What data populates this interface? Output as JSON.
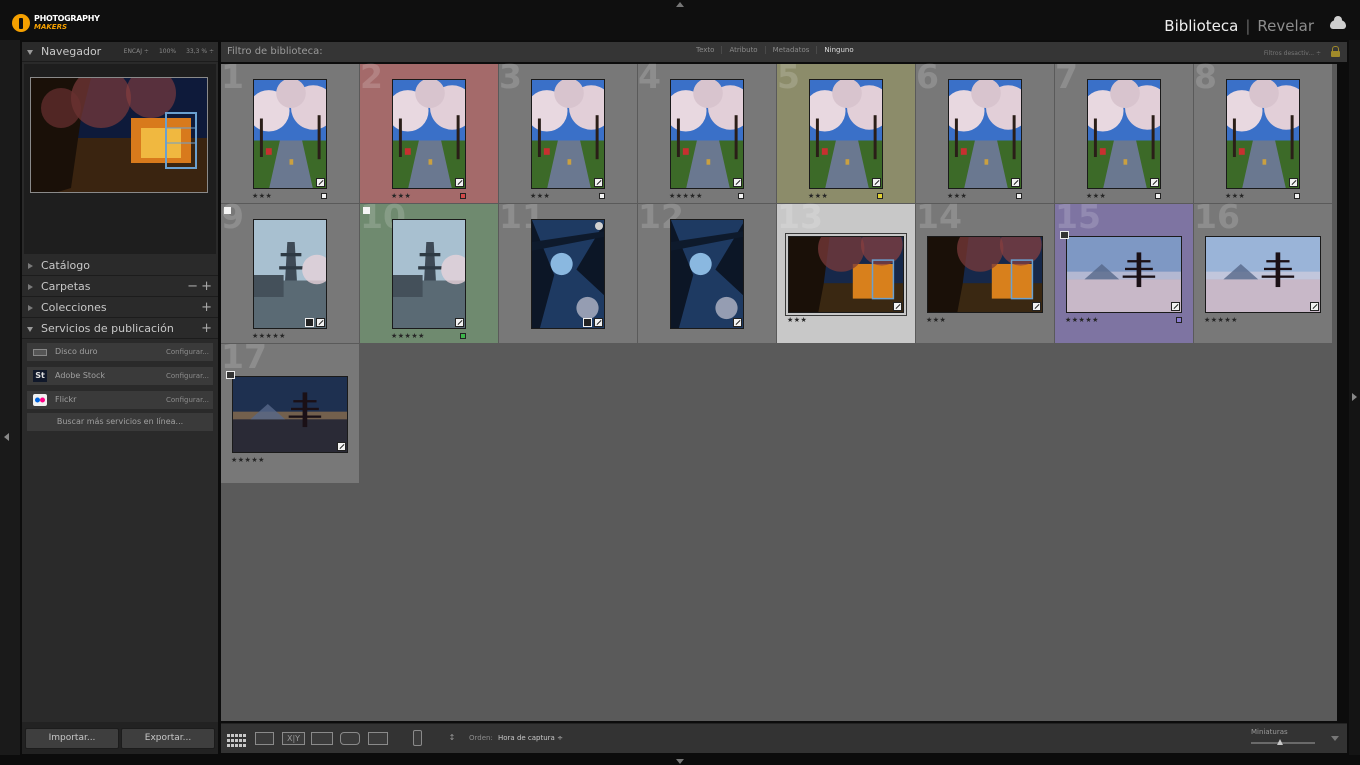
{
  "app": {
    "logo_line1": "PHOTOGRAPHY",
    "logo_line2": "MAKERS",
    "modules": {
      "active": "Biblioteca",
      "other": "Revelar",
      "separator": "|"
    }
  },
  "left_panel": {
    "navigator": {
      "title": "Navegador",
      "zoom_options": [
        "ENCAJ ÷",
        "100%",
        "33,3 % ÷"
      ]
    },
    "sections": [
      {
        "label": "Catálogo",
        "action": ""
      },
      {
        "label": "Carpetas",
        "action": "+",
        "action2": "−"
      },
      {
        "label": "Colecciones",
        "action": "+"
      },
      {
        "label": "Servicios de publicación",
        "action": "+"
      }
    ],
    "publish_services": [
      {
        "name": "Disco duro",
        "configure": "Configurar...",
        "icon": "hard-drive-icon"
      },
      {
        "name": "Adobe Stock",
        "configure": "Configurar...",
        "icon": "adobe-stock-icon"
      },
      {
        "name": "Flickr",
        "configure": "Configurar...",
        "icon": "flickr-icon"
      }
    ],
    "find_more": "Buscar más servicios en línea...",
    "import_label": "Importar...",
    "export_label": "Exportar..."
  },
  "filter_bar": {
    "title": "Filtro de biblioteca:",
    "tabs": [
      "Texto",
      "Atributo",
      "Metadatos",
      "Ninguno"
    ],
    "selected_tab": "Ninguno",
    "preset": "Filtros desactiv... ÷"
  },
  "grid": {
    "cells": [
      {
        "num": "1",
        "stars": "★★★",
        "color": "none",
        "label": "white",
        "scene": "blossom"
      },
      {
        "num": "2",
        "stars": "★★★",
        "color": "red",
        "label": "red",
        "scene": "blossom"
      },
      {
        "num": "3",
        "stars": "★★★",
        "color": "none",
        "label": "white",
        "scene": "blossom"
      },
      {
        "num": "4",
        "stars": "★★★★★",
        "color": "none",
        "label": "white",
        "scene": "blossom"
      },
      {
        "num": "5",
        "stars": "★★★",
        "color": "yellow",
        "label": "yellow",
        "scene": "blossom"
      },
      {
        "num": "6",
        "stars": "★★★",
        "color": "none",
        "label": "white",
        "scene": "blossom"
      },
      {
        "num": "7",
        "stars": "★★★",
        "color": "none",
        "label": "white",
        "scene": "blossom"
      },
      {
        "num": "8",
        "stars": "★★★",
        "color": "none",
        "label": "white",
        "scene": "blossom"
      },
      {
        "num": "9",
        "stars": "★★★★★",
        "color": "none",
        "label": "",
        "scene": "pagoda-mist"
      },
      {
        "num": "10",
        "stars": "★★★★★",
        "color": "green",
        "label": "green",
        "scene": "pagoda-mist"
      },
      {
        "num": "11",
        "stars": "",
        "color": "none",
        "label": "",
        "scene": "night-tree"
      },
      {
        "num": "12",
        "stars": "",
        "color": "none",
        "label": "",
        "scene": "night-tree"
      },
      {
        "num": "13",
        "stars": "★★★",
        "color": "selected",
        "label": "",
        "scene": "night-lanterns"
      },
      {
        "num": "14",
        "stars": "★★★",
        "color": "none",
        "label": "",
        "scene": "night-lanterns"
      },
      {
        "num": "15",
        "stars": "★★★★★",
        "color": "purple",
        "label": "purple",
        "scene": "pagoda-dusk"
      },
      {
        "num": "16",
        "stars": "★★★★★",
        "color": "none",
        "label": "",
        "scene": "pagoda-day"
      },
      {
        "num": "17",
        "stars": "★★★★★",
        "color": "none",
        "label": "",
        "scene": "pagoda-night"
      }
    ]
  },
  "toolbar": {
    "sort_label": "Orden:",
    "sort_value": "Hora de captura ÷",
    "thumbnails_label": "Miniaturas",
    "thumbnail_size": 0.45
  },
  "colors": {
    "accent": "#f5a000",
    "red_label": "#d04a4a",
    "yellow_label": "#e0d030",
    "green_label": "#3cb44a",
    "purple_label": "#8a7ad0"
  }
}
